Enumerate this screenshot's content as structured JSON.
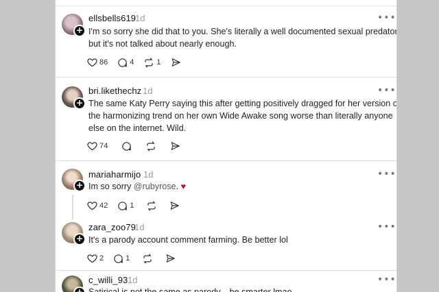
{
  "posts": [
    {
      "username": "ellsbells619",
      "time": "1d",
      "text": "I'm so sorry she did that to you. She's literally a well documented sexual predator but it's not talked about nearly enough.",
      "likes": "86",
      "replies": "4",
      "reposts": "1",
      "avatar_color": "#8a6f7d"
    },
    {
      "username": "bri.likethechz",
      "time": "1d",
      "text": "The same Katy Perry saying this after getting positively dragged for her version of the harmonizing trend on her own Wide Awake song worse than literally anyone else on the internet. Wild.",
      "likes": "74",
      "replies": "",
      "reposts": "",
      "avatar_color": "#6b5a52"
    },
    {
      "username": "mariaharmijo",
      "time": "1d",
      "text_before": "Im so sorry ",
      "mention": "@rubyrose",
      "text_after": ". ",
      "emoji": "♥",
      "likes": "42",
      "replies": "1",
      "reposts": "",
      "avatar_color": "#9b7e6b"
    },
    {
      "username": "zara_zoo79",
      "time": "1d",
      "text": "It's a parody account comment farming. Be better lol",
      "likes": "2",
      "replies": "1",
      "reposts": "",
      "avatar_color": "#a8907a"
    },
    {
      "username": "c_willi_93",
      "time": "1d",
      "text": "Satirical is not the same as parody... be smarter lmao",
      "avatar_color": "#4d5a3f"
    }
  ],
  "more_glyph": "•••",
  "follow_glyph": "+"
}
